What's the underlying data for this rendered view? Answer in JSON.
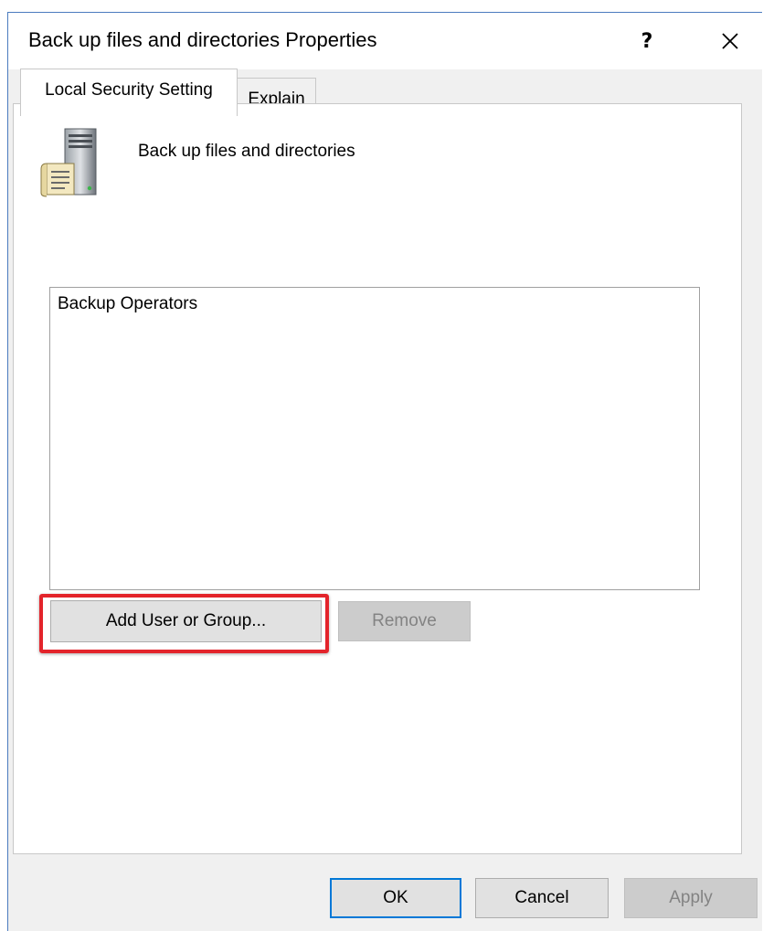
{
  "dialog": {
    "title": "Back up files and directories Properties",
    "help_label": "?",
    "close_icon": "close-icon"
  },
  "tabs": [
    {
      "label": "Local Security Setting",
      "active": true
    },
    {
      "label": "Explain",
      "active": false
    }
  ],
  "policy": {
    "name": "Back up files and directories",
    "icon": "server-policy-icon"
  },
  "members": [
    "Backup Operators"
  ],
  "buttons": {
    "add": "Add User or Group...",
    "remove": "Remove",
    "ok": "OK",
    "cancel": "Cancel",
    "apply": "Apply"
  },
  "colors": {
    "highlight": "#e3242b",
    "focus": "#0078d7",
    "window_border": "#4b7bbf"
  }
}
